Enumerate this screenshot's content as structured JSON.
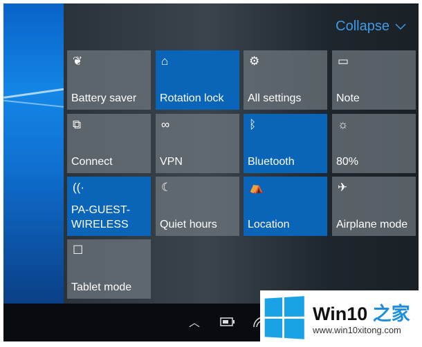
{
  "header": {
    "collapse_label": "Collapse"
  },
  "tiles": [
    {
      "label": "Battery saver",
      "icon": "leaf-icon",
      "active": false
    },
    {
      "label": "Rotation lock",
      "icon": "rotation-lock-icon",
      "active": true
    },
    {
      "label": "All settings",
      "icon": "gear-icon",
      "active": false
    },
    {
      "label": "Note",
      "icon": "note-icon",
      "active": false
    },
    {
      "label": "Connect",
      "icon": "connect-icon",
      "active": false
    },
    {
      "label": "VPN",
      "icon": "vpn-icon",
      "active": false
    },
    {
      "label": "Bluetooth",
      "icon": "bluetooth-icon",
      "active": true
    },
    {
      "label": "80%",
      "icon": "brightness-icon",
      "active": false
    },
    {
      "label": "PA-GUEST-\nWIRELESS",
      "icon": "wifi-icon",
      "active": true
    },
    {
      "label": "Quiet hours",
      "icon": "moon-icon",
      "active": false
    },
    {
      "label": "Location",
      "icon": "location-icon",
      "active": true
    },
    {
      "label": "Airplane mode",
      "icon": "airplane-icon",
      "active": false
    },
    {
      "label": "Tablet mode",
      "icon": "tablet-mode-icon",
      "active": false
    }
  ],
  "colors": {
    "accent": "#0a64b8",
    "link": "#3f9be6"
  },
  "watermark": {
    "brand": "Win10",
    "brand_cn": "之家",
    "url": "www.win10xitong.com"
  }
}
